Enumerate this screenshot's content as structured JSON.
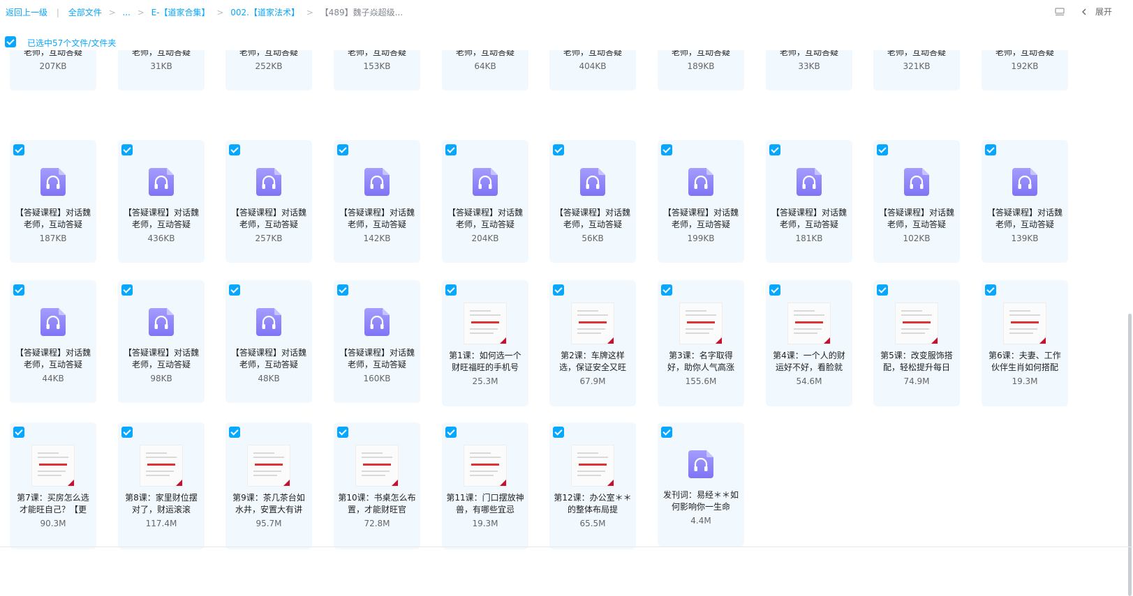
{
  "breadcrumb": {
    "back_label": "返回上一级",
    "sep_bar": "|",
    "items": [
      "全部文件",
      "...",
      "E-【道家合集】",
      "002.【道家法术】"
    ],
    "current": "【489】魏子焱超级...",
    "arrow": ">"
  },
  "toolbar": {
    "expand_label": "展开"
  },
  "selection": {
    "text": "已选中57个文件/文件夹"
  },
  "colors": {
    "accent": "#06a7ff",
    "card_bg": "#f1f8fe",
    "audio_icon": "#8f86ff"
  },
  "files": [
    {
      "name": "【答疑课程】对话魏老师，互动答疑",
      "size": "207KB",
      "type": "audio"
    },
    {
      "name": "【答疑课程】对话魏老师，互动答疑",
      "size": "31KB",
      "type": "audio"
    },
    {
      "name": "【答疑课程】对话魏老师，互动答疑",
      "size": "252KB",
      "type": "audio"
    },
    {
      "name": "【答疑课程】对话魏老师，互动答疑",
      "size": "153KB",
      "type": "audio"
    },
    {
      "name": "【答疑课程】对话魏老师，互动答疑",
      "size": "64KB",
      "type": "audio"
    },
    {
      "name": "【答疑课程】对话魏老师，互动答疑",
      "size": "404KB",
      "type": "audio"
    },
    {
      "name": "【答疑课程】对话魏老师，互动答疑",
      "size": "189KB",
      "type": "audio"
    },
    {
      "name": "【答疑课程】对话魏老师，互动答疑",
      "size": "33KB",
      "type": "audio"
    },
    {
      "name": "【答疑课程】对话魏老师，互动答疑",
      "size": "321KB",
      "type": "audio"
    },
    {
      "name": "【答疑课程】对话魏老师，互动答疑",
      "size": "192KB",
      "type": "audio"
    },
    {
      "name": "【答疑课程】对话魏老师，互动答疑",
      "size": "187KB",
      "type": "audio"
    },
    {
      "name": "【答疑课程】对话魏老师，互动答疑",
      "size": "436KB",
      "type": "audio"
    },
    {
      "name": "【答疑课程】对话魏老师，互动答疑",
      "size": "257KB",
      "type": "audio"
    },
    {
      "name": "【答疑课程】对话魏老师，互动答疑",
      "size": "142KB",
      "type": "audio"
    },
    {
      "name": "【答疑课程】对话魏老师，互动答疑",
      "size": "204KB",
      "type": "audio"
    },
    {
      "name": "【答疑课程】对话魏老师，互动答疑",
      "size": "56KB",
      "type": "audio"
    },
    {
      "name": "【答疑课程】对话魏老师，互动答疑",
      "size": "199KB",
      "type": "audio"
    },
    {
      "name": "【答疑课程】对话魏老师，互动答疑",
      "size": "181KB",
      "type": "audio"
    },
    {
      "name": "【答疑课程】对话魏老师，互动答疑",
      "size": "102KB",
      "type": "audio"
    },
    {
      "name": "【答疑课程】对话魏老师，互动答疑",
      "size": "139KB",
      "type": "audio"
    },
    {
      "name": "【答疑课程】对话魏老师，互动答疑",
      "size": "44KB",
      "type": "audio"
    },
    {
      "name": "【答疑课程】对话魏老师，互动答疑",
      "size": "98KB",
      "type": "audio"
    },
    {
      "name": "【答疑课程】对话魏老师，互动答疑",
      "size": "48KB",
      "type": "audio"
    },
    {
      "name": "【答疑课程】对话魏老师，互动答疑",
      "size": "160KB",
      "type": "audio"
    },
    {
      "name": "第1课：如何选一个财旺福旺的手机号",
      "size": "25.3M",
      "type": "video"
    },
    {
      "name": "第2课：车牌这样选，保证安全又旺",
      "size": "67.9M",
      "type": "video"
    },
    {
      "name": "第3课：名字取得好，助你人气高涨",
      "size": "155.6M",
      "type": "video"
    },
    {
      "name": "第4课：一个人的财运好不好，看脸就",
      "size": "54.6M",
      "type": "video"
    },
    {
      "name": "第5课：改变服饰搭配，轻松提升每日",
      "size": "74.9M",
      "type": "video"
    },
    {
      "name": "第6课：夫妻、工作伙伴生肖如何搭配",
      "size": "19.3M",
      "type": "video"
    },
    {
      "name": "第7课：买房怎么选才能旺自己？【更",
      "size": "90.3M",
      "type": "video"
    },
    {
      "name": "第8课：家里财位摆对了，财运滚滚",
      "size": "117.4M",
      "type": "video"
    },
    {
      "name": "第9课：茶几茶台如水井，安置大有讲",
      "size": "95.7M",
      "type": "video"
    },
    {
      "name": "第10课：书桌怎么布置，才能财旺官",
      "size": "72.8M",
      "type": "video"
    },
    {
      "name": "第11课：门口摆放神兽，有哪些宜忌",
      "size": "19.3M",
      "type": "video"
    },
    {
      "name": "第12课：办公室＊＊的整体布局提",
      "size": "65.5M",
      "type": "video"
    },
    {
      "name": "发刊词：易经＊＊如何影响你一生命",
      "size": "4.4M",
      "type": "audio"
    }
  ]
}
